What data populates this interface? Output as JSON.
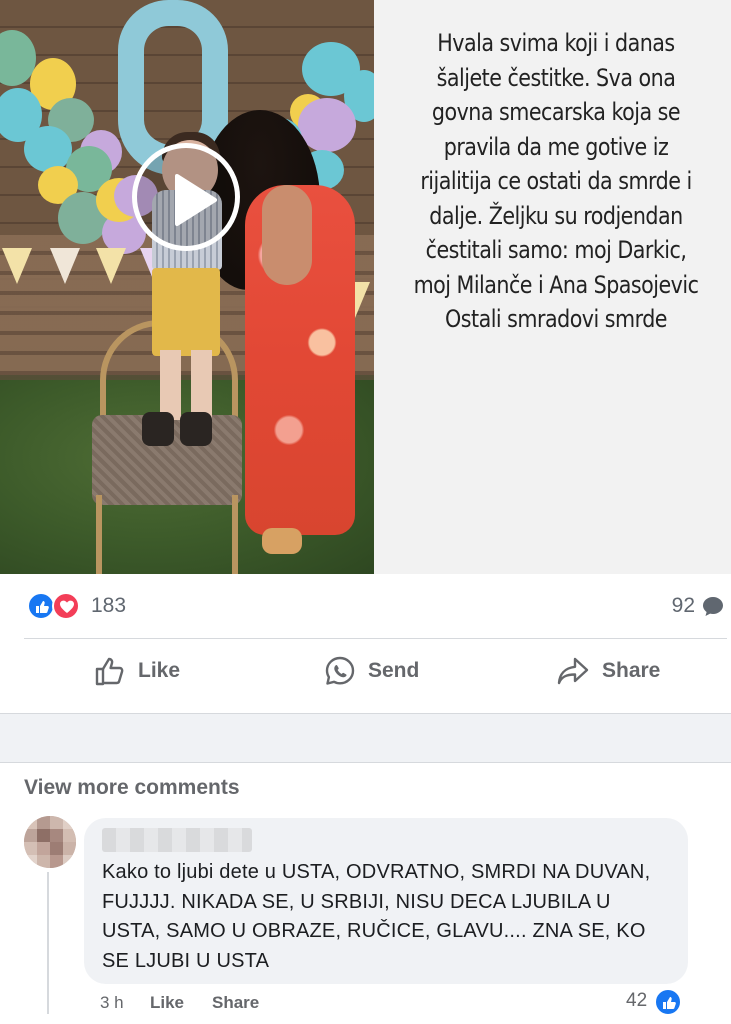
{
  "post": {
    "caption_lines": [
      "Hvala svima koji i danas",
      "šaljete čestitke. Sva ona",
      "govna smecarska koja se",
      "pravila da me gotive iz",
      "rijalitija ce ostati da smrde i",
      "dalje. Željku su rodjendan",
      "čestitali samo: moj Darkic,",
      "moj Milanče i Ana Spasojevic",
      "Ostali smradovi smrde"
    ],
    "colors": {
      "panel_bg": "#f2f2f2",
      "play_ring": "#ffffff"
    }
  },
  "reactions": {
    "count": "183",
    "comments_count": "92",
    "icons": [
      "like-icon",
      "love-icon"
    ]
  },
  "actions": {
    "like_label": "Like",
    "send_label": "Send",
    "share_label": "Share"
  },
  "comments": {
    "view_more_label": "View more comments",
    "items": [
      {
        "text": "Kako to ljubi dete u USTA, ODVRATNO, SMRDI NA DUVAN, FUJJJJ. NIKADA SE, U SRBIJI, NISU DECA LJUBILA U USTA, SAMO U OBRAZE, RUČICE, GLAVU.... ZNA SE, KO SE LJUBI U USTA",
        "time": "3 h",
        "like_label": "Like",
        "share_label": "Share",
        "likes": "42"
      }
    ]
  },
  "theme": {
    "brand_blue": "#1877f2",
    "love_red": "#f33e58",
    "muted_text": "#65676b"
  }
}
